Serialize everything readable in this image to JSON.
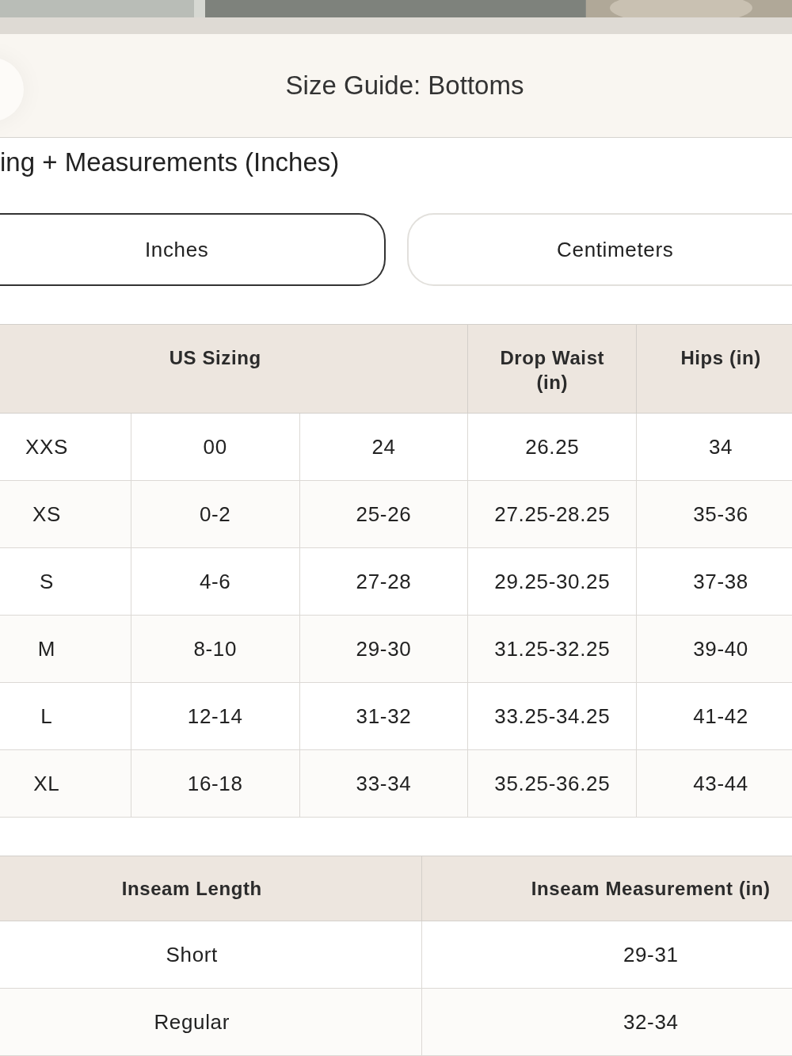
{
  "modal": {
    "title": "Size Guide: Bottoms"
  },
  "section_heading": "ing + Measurements (Inches)",
  "units": [
    {
      "label": "Inches",
      "selected": true
    },
    {
      "label": "Centimeters",
      "selected": false
    }
  ],
  "size_table": {
    "headers": [
      "US Sizing",
      "Drop Waist (in)",
      "Hips (in)"
    ],
    "rows": [
      [
        "XXS",
        "00",
        "24",
        "26.25",
        "34"
      ],
      [
        "XS",
        "0-2",
        "25-26",
        "27.25-28.25",
        "35-36"
      ],
      [
        "S",
        "4-6",
        "27-28",
        "29.25-30.25",
        "37-38"
      ],
      [
        "M",
        "8-10",
        "29-30",
        "31.25-32.25",
        "39-40"
      ],
      [
        "L",
        "12-14",
        "31-32",
        "33.25-34.25",
        "41-42"
      ],
      [
        "XL",
        "16-18",
        "33-34",
        "35.25-36.25",
        "43-44"
      ]
    ]
  },
  "inseam_table": {
    "headers": [
      "Inseam Length",
      "Inseam Measurement (in)"
    ],
    "rows": [
      [
        "Short",
        "29-31"
      ],
      [
        "Regular",
        "32-34"
      ]
    ]
  }
}
